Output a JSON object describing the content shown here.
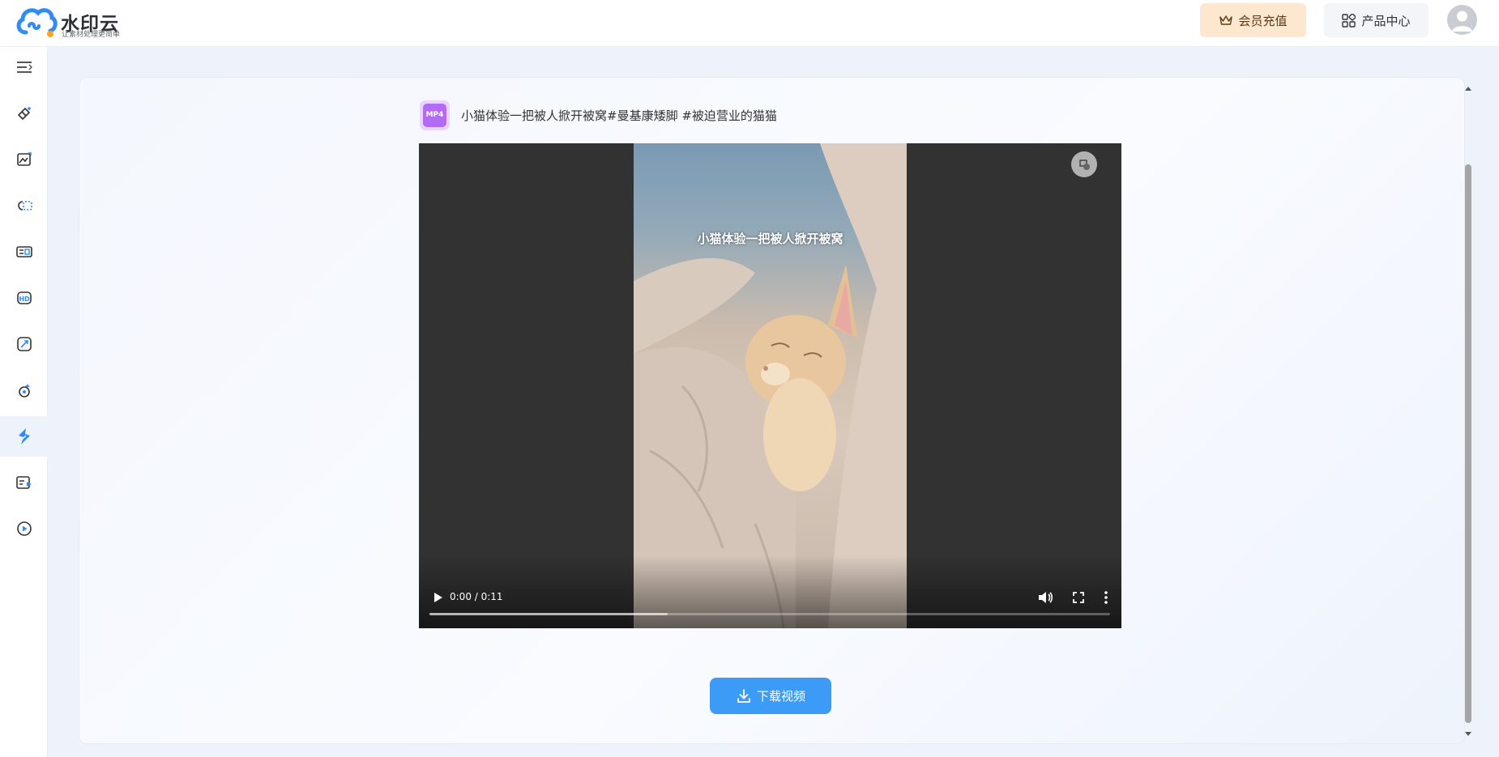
{
  "brand": {
    "name": "水印云",
    "slogan": "让素材处理更简单"
  },
  "header": {
    "vip_label": "会员充值",
    "products_label": "产品中心"
  },
  "sidebar": {
    "items": [
      {
        "icon": "menu-collapse-icon"
      },
      {
        "icon": "eraser-icon"
      },
      {
        "icon": "image-edit-icon"
      },
      {
        "icon": "cutout-icon"
      },
      {
        "icon": "id-photo-icon"
      },
      {
        "icon": "hd-icon"
      },
      {
        "icon": "image-resize-icon"
      },
      {
        "icon": "ai-generate-icon"
      },
      {
        "icon": "video-parse-icon",
        "active": true
      },
      {
        "icon": "video-edit-icon"
      },
      {
        "icon": "video-play-icon"
      }
    ]
  },
  "file": {
    "badge": "MP4",
    "title": "小猫体验一把被人掀开被窝#曼基康矮脚 #被迫营业的猫猫"
  },
  "video": {
    "caption": "小猫体验一把被人掀开被窝",
    "time": "0:00 / 0:11",
    "buffered_fraction": 0.35
  },
  "download": {
    "label": "下载视频"
  },
  "colors": {
    "accent": "#3d9bf8",
    "vip_bg": "#fde7cf",
    "mp4_badge": "#b26bf2"
  }
}
